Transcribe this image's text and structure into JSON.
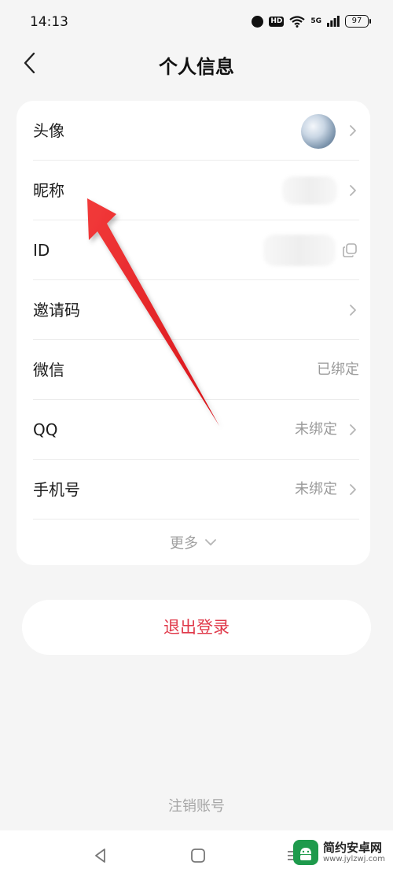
{
  "status": {
    "time": "14:13",
    "hd": "HD",
    "network": "5G",
    "battery": "97"
  },
  "header": {
    "title": "个人信息"
  },
  "rows": [
    {
      "label": "头像"
    },
    {
      "label": "昵称"
    },
    {
      "label": "ID"
    },
    {
      "label": "邀请码"
    },
    {
      "label": "微信",
      "value": "已绑定"
    },
    {
      "label": "QQ",
      "value": "未绑定"
    },
    {
      "label": "手机号",
      "value": "未绑定"
    }
  ],
  "more_label": "更多",
  "logout_label": "退出登录",
  "cancel_account_label": "注销账号",
  "watermark": {
    "title": "简约安卓网",
    "url": "www.jylzwj.com"
  },
  "colors": {
    "accent_red": "#e0394a",
    "arrow_red": "#e8252a",
    "background": "#f5f5f5"
  }
}
